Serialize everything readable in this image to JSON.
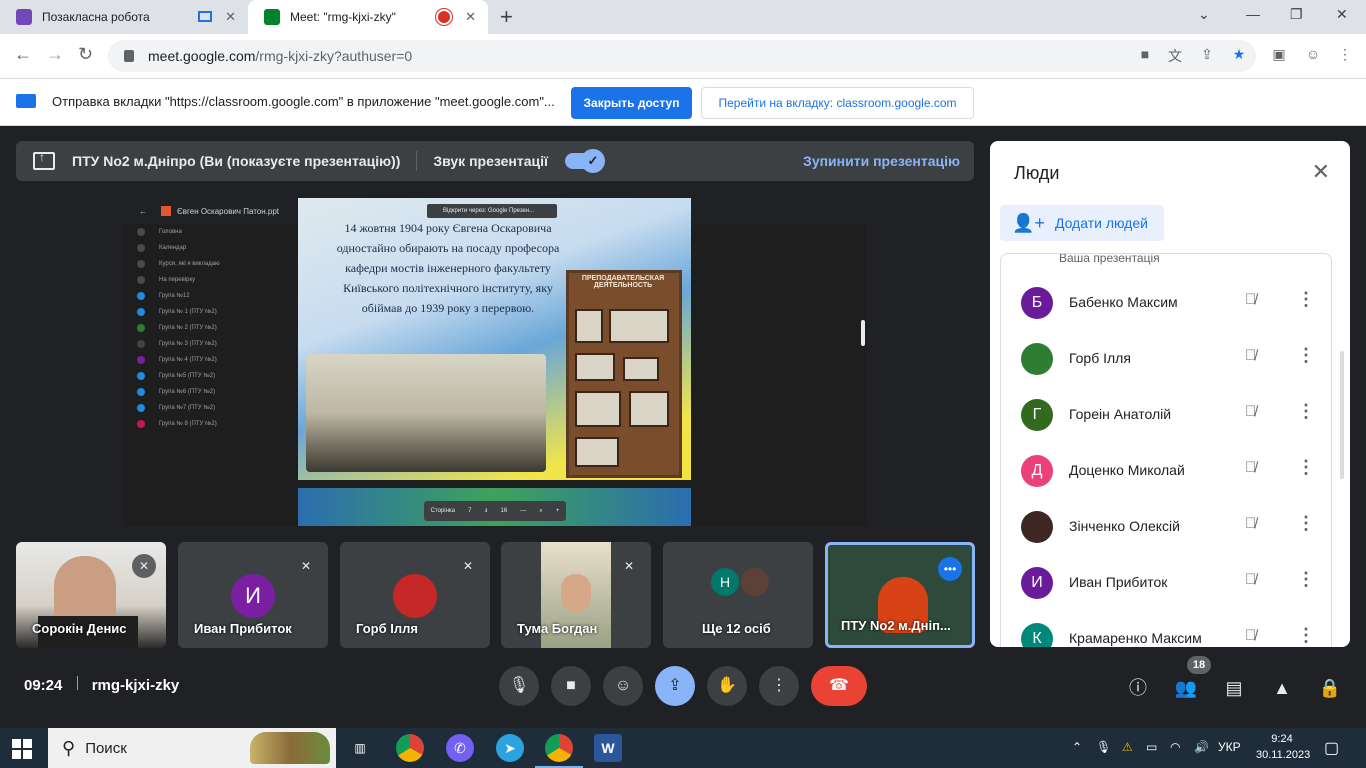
{
  "browser": {
    "tabs": [
      {
        "title": "Позакласна робота",
        "fav_color": "#7248b9"
      },
      {
        "title": "Meet: \"rmg-kjxi-zky\"",
        "fav_color": "#00832d"
      }
    ],
    "url_main": "meet.google.com",
    "url_rest": "/rmg-kjxi-zky?authuser=0"
  },
  "infobar": {
    "text": "Отправка вкладки \"https://classroom.google.com\" в приложение \"meet.google.com\"...",
    "share_button": "Закрыть доступ",
    "switch_button": "Перейти на вкладку: classroom.google.com"
  },
  "presentation_bar": {
    "presenter": "ПТУ No2 м.Дніпро (Ви (показуєте презентацію))",
    "audio_label": "Звук презентації",
    "stop_label": "Зупинити презентацію"
  },
  "shared_screen": {
    "file_title": "Євген Оскарович Патон.ppt",
    "open_with": "Відкрити через: Google Презен...",
    "sidebar_items": [
      "Головна",
      "Календар",
      "Курси, які я викладаю",
      "На перевірку",
      "Група №12",
      "Група № 1 (ПТУ №2)",
      "Група № 2 (ПТУ №2)",
      "Група № 3 (ПТУ №2)",
      "Група № 4 (ПТУ №2)",
      "Група №5 (ПТУ №2)",
      "Група №6 (ПТУ №2)",
      "Група №7 (ПТУ №2)",
      "Група № 8 (ПТУ №2)"
    ],
    "slide_text": "14 жовтня 1904 року Євгена Оскаровича одностайно обирають на посаду професора кафедри мостів інженерного факультету Київського політехнічного інституту, яку обіймав до 1939 року з перервою.",
    "board_title": "ПРЕПОДАВАТЕЛЬСКАЯ ДЕЯТЕЛЬНОСТЬ",
    "page_label": "Сторінка",
    "page_current": "7",
    "page_of": "з",
    "page_total": "16"
  },
  "tiles": [
    {
      "name": "Сорокін Денис",
      "type": "video"
    },
    {
      "name": "Иван Прибиток",
      "type": "avatar",
      "initial": "И",
      "color": "#7b1fa2"
    },
    {
      "name": "Горб Ілля",
      "type": "photo"
    },
    {
      "name": "Тума Богдан",
      "type": "video"
    },
    {
      "name": "Ще 12 осіб",
      "type": "group",
      "initial": "Н",
      "color": "#00796b"
    },
    {
      "name": "ПТУ No2 м.Дніп...",
      "type": "self"
    }
  ],
  "meeting": {
    "time": "09:24",
    "code": "rmg-kjxi-zky",
    "participants_count": "18"
  },
  "people_panel": {
    "title": "Люди",
    "add_button": "Додати людей",
    "presentation_item": "Ваша презентація",
    "people": [
      {
        "name": "Бабенко Максим",
        "initial": "Б",
        "color": "#6a1b9a"
      },
      {
        "name": "Горб Ілля",
        "initial": "",
        "color": "#2e7d32"
      },
      {
        "name": "Гореін Анатолій",
        "initial": "Г",
        "color": "#33691e"
      },
      {
        "name": "Доценко Миколай",
        "initial": "Д",
        "color": "#ec407a"
      },
      {
        "name": "Зінченко Олексій",
        "initial": "",
        "color": "#3e2723"
      },
      {
        "name": "Иван Прибиток",
        "initial": "И",
        "color": "#6a1b9a"
      },
      {
        "name": "Крамаренко Максим",
        "initial": "К",
        "color": "#00897b"
      }
    ]
  },
  "taskbar": {
    "search_placeholder": "Поиск",
    "language": "УКР",
    "time": "9:24",
    "date": "30.11.2023"
  }
}
